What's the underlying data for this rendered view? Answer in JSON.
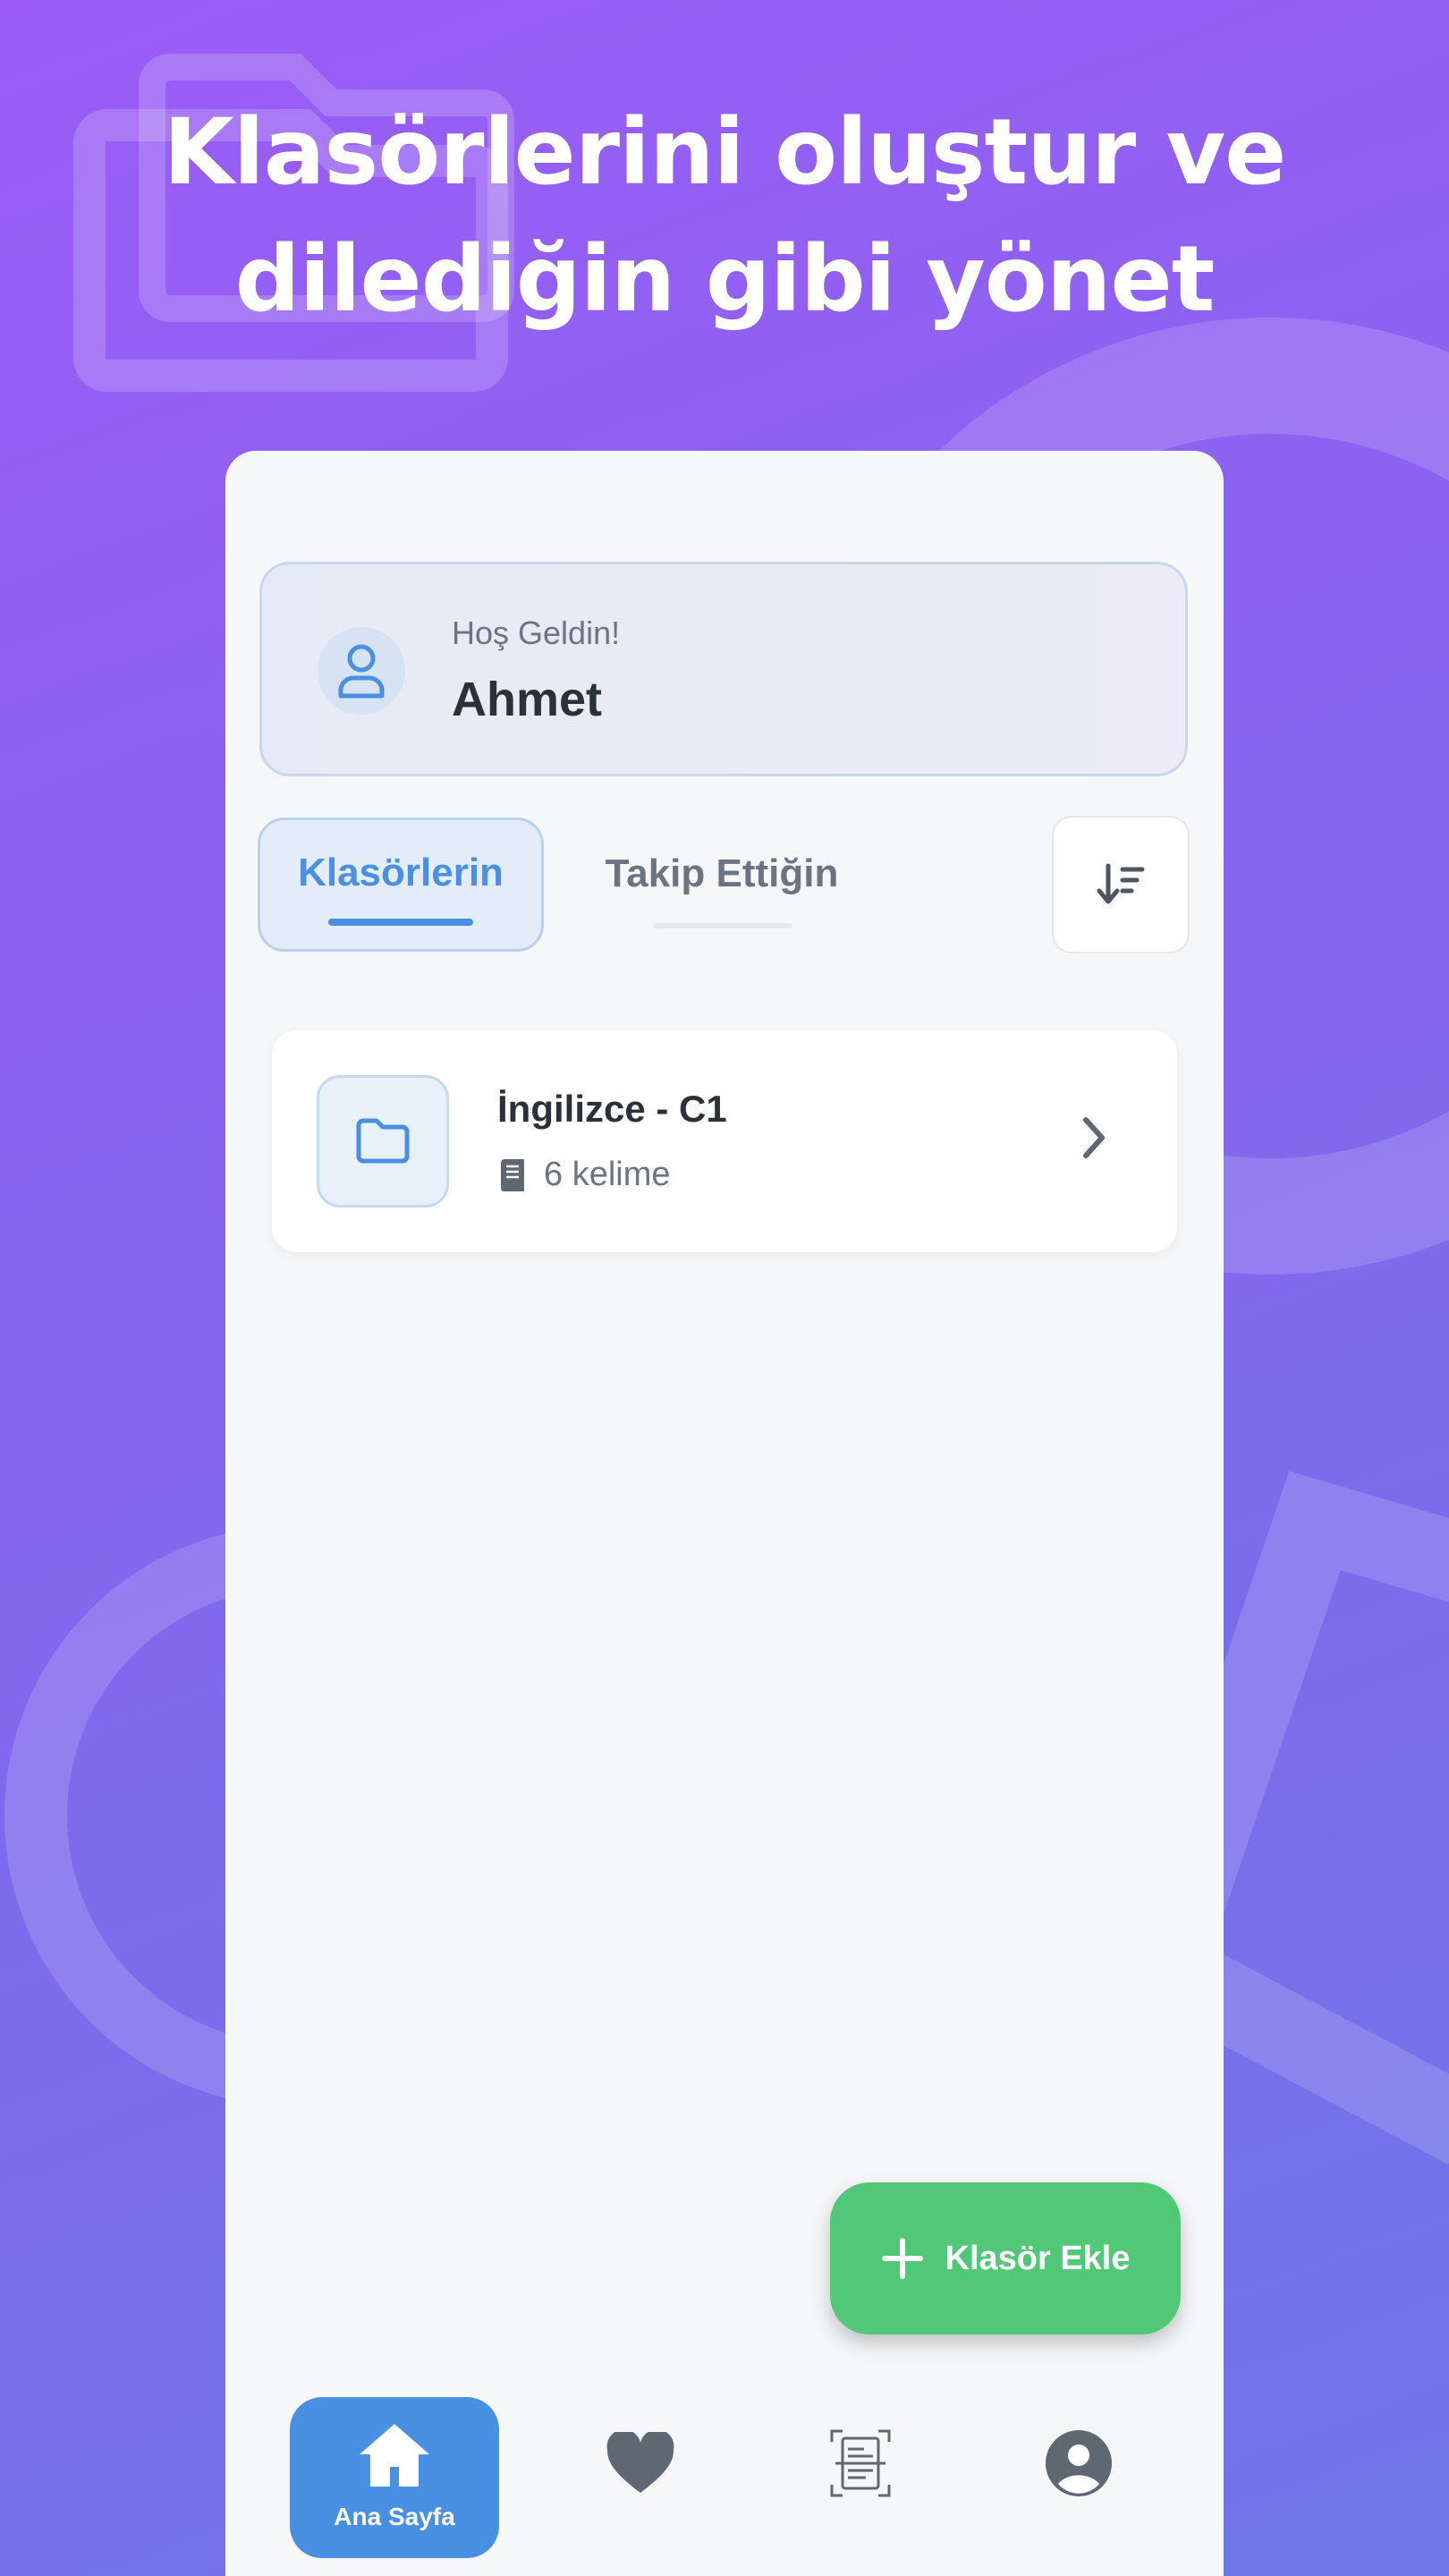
{
  "headline": {
    "line1": "Klasörlerini oluştur ve",
    "line2": "dilediğin gibi yönet"
  },
  "welcome": {
    "greeting": "Hoş Geldin!",
    "name": "Ahmet",
    "icon": "user-icon"
  },
  "tabs": [
    {
      "label": "Klasörlerin",
      "active": true
    },
    {
      "label": "Takip Ettiğin",
      "active": false
    }
  ],
  "sort": {
    "icon": "sort-descending-icon"
  },
  "folders": [
    {
      "name": "İngilizce - C1",
      "count": "6 kelime",
      "icon": "folder-icon"
    }
  ],
  "fab": {
    "label": "Klasör Ekle",
    "icon": "plus-icon"
  },
  "nav": [
    {
      "label": "Ana Sayfa",
      "icon": "home-icon",
      "active": true
    },
    {
      "icon": "heart-icon",
      "active": false
    },
    {
      "icon": "document-scan-icon",
      "active": false
    },
    {
      "icon": "account-circle-icon",
      "active": false
    }
  ],
  "colors": {
    "accent": "#4a90e2",
    "fab": "#50c878",
    "text_dark": "#2b3138",
    "text_muted": "#6b7480"
  }
}
